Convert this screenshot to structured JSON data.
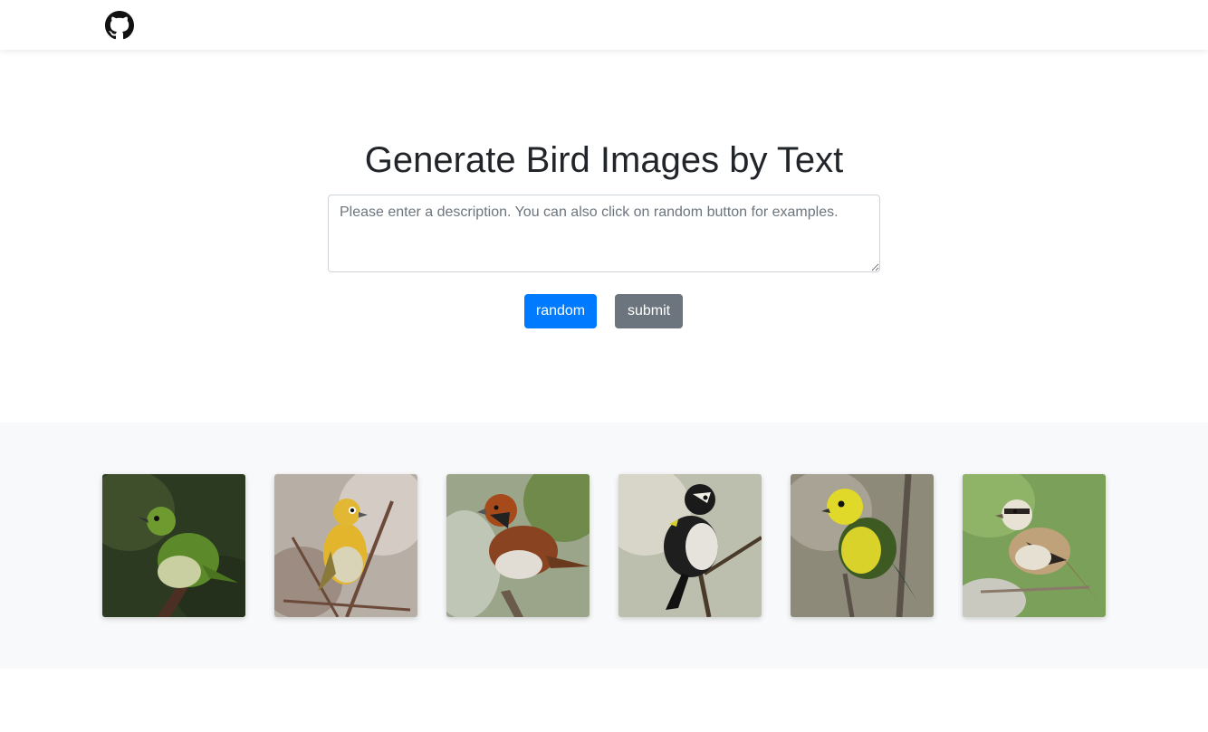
{
  "nav": {
    "icon": "github-icon"
  },
  "hero": {
    "title": "Generate Bird Images by Text",
    "description_placeholder": "Please enter a description. You can also click on random button for examples.",
    "description_value": "",
    "random_label": "random",
    "submit_label": "submit"
  },
  "colors": {
    "primary": "#007bff",
    "secondary": "#6c757d",
    "gallery_bg": "#f8f9fa"
  },
  "gallery": {
    "images": [
      {
        "name": "green-bird-image"
      },
      {
        "name": "yellow-bird-image"
      },
      {
        "name": "rufous-sparrow-image"
      },
      {
        "name": "black-white-warbler-image"
      },
      {
        "name": "yellow-green-warbler-image"
      },
      {
        "name": "striped-sparrow-image"
      }
    ]
  }
}
